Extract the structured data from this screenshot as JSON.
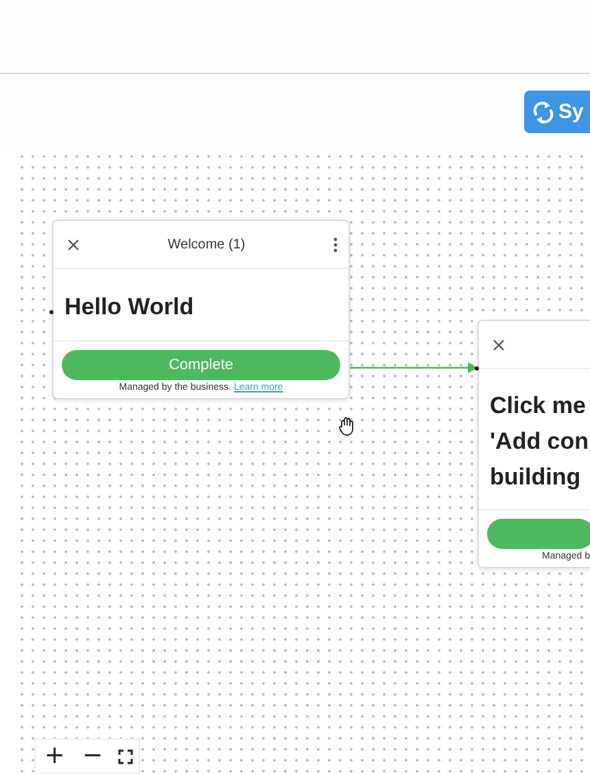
{
  "toolbar": {
    "sync_button": "Sy"
  },
  "nodes": [
    {
      "title": "Welcome (1)",
      "body": [
        "Hello World"
      ],
      "button": "Complete",
      "footer": "Managed by the business.",
      "footer_link": "Learn more"
    },
    {
      "body": [
        "Click me",
        "'Add con",
        "building"
      ],
      "footer": "Managed b"
    }
  ],
  "zoom_controls": [
    "+",
    "−"
  ]
}
